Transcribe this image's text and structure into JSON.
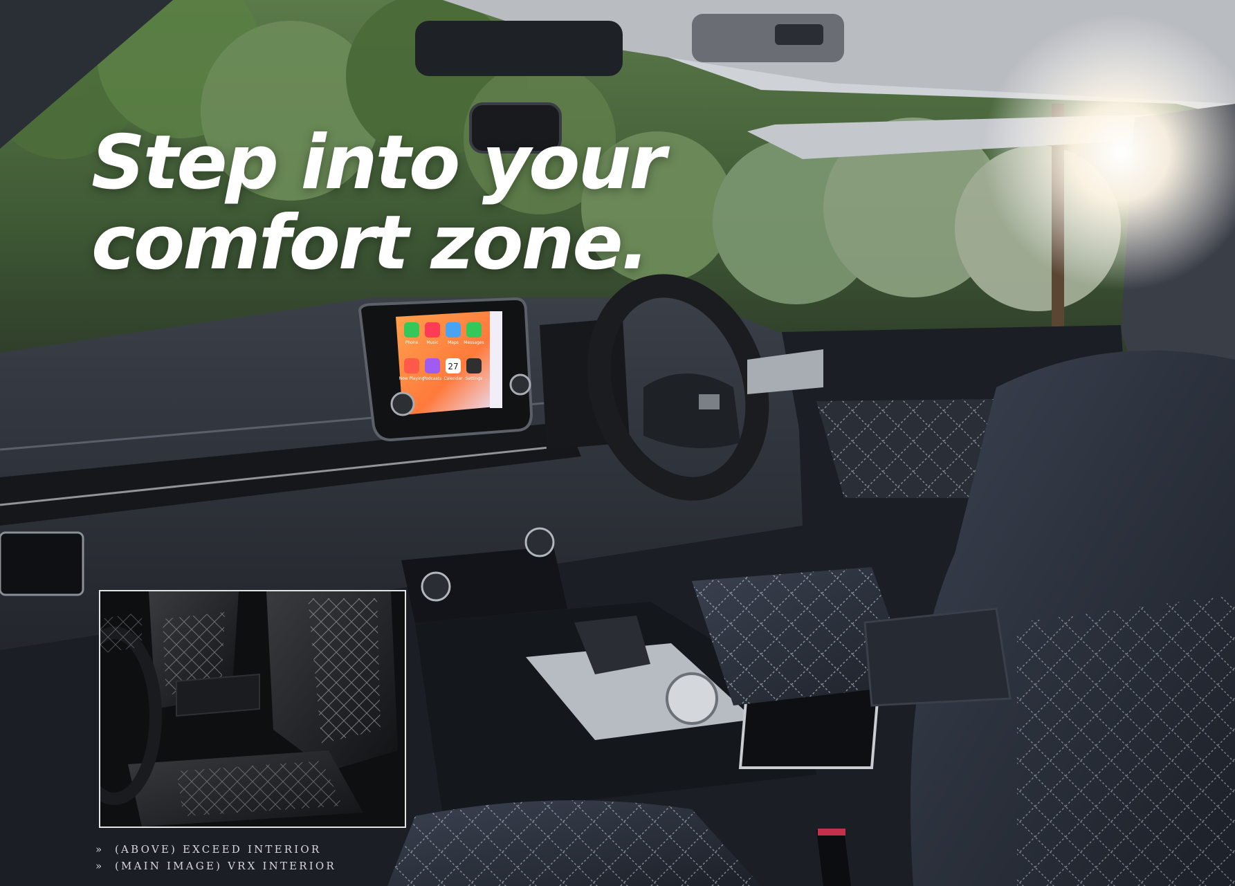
{
  "headline": {
    "line1": "Step into your",
    "line2": "comfort zone."
  },
  "infotainment": {
    "apps": [
      {
        "label": "Phone",
        "color": "#34c759"
      },
      {
        "label": "Music",
        "color": "#ff3b55"
      },
      {
        "label": "Maps",
        "color": "#4aa3f0"
      },
      {
        "label": "Messages",
        "color": "#34c759"
      },
      {
        "label": "Now Playing",
        "color": "#ff5a4a"
      },
      {
        "label": "Podcasts",
        "color": "#a05cf0"
      },
      {
        "label": "Calendar",
        "color": "#ffffff"
      },
      {
        "label": "Settings",
        "color": "#2f2f2f"
      }
    ],
    "calendar_day": "27"
  },
  "captions": [
    {
      "marker": "»",
      "text": "(above) exceed interior"
    },
    {
      "marker": "»",
      "text": "(main image) vrx interior"
    }
  ]
}
